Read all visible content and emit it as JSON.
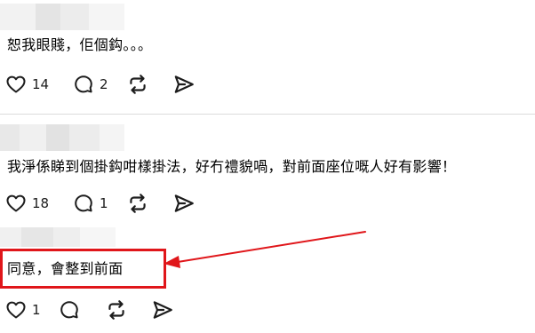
{
  "posts": [
    {
      "text": "恕我眼賤，佢個鈎。。。",
      "likes": "14",
      "replies": "2"
    },
    {
      "text": "我淨係睇到個掛鈎咁樣掛法，好冇禮貌喎，對前面座位嘅人好有影響！",
      "likes": "18",
      "replies": "1"
    },
    {
      "text": "同意，會整到前面",
      "likes": "1",
      "replies": ""
    }
  ],
  "icons": {
    "like": "heart-icon",
    "reply": "comment-icon",
    "repost": "repost-icon",
    "share": "send-icon"
  },
  "colors": {
    "annotation": "#e0161a",
    "text": "#000000",
    "icon": "#1c1c1c"
  }
}
